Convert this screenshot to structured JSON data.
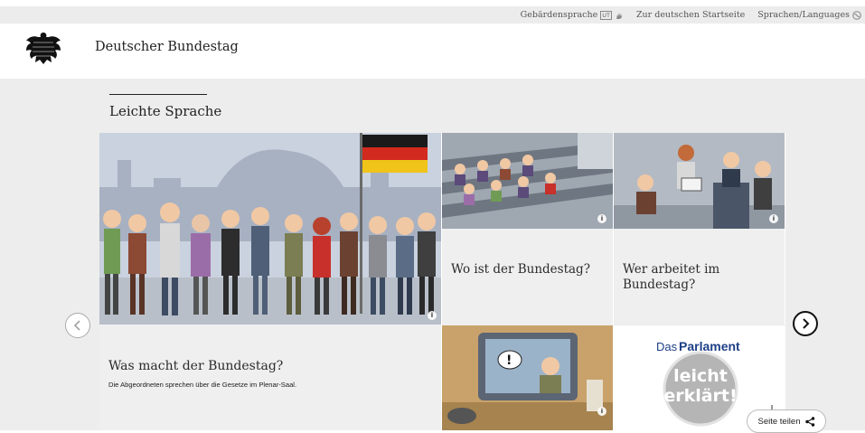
{
  "topbar": {
    "sign_language": "Gebärdensprache",
    "ut_badge": "UT",
    "home_german": "Zur deutschen Startseite",
    "languages": "Sprachen/Languages"
  },
  "header": {
    "site_title": "Deutscher Bundestag"
  },
  "section": {
    "title": "Leichte Sprache"
  },
  "tiles": [
    {
      "title": "Was macht der Bundestag?",
      "description": "Die Abgeordneten sprechen über die Gesetze im Plenar-Saal."
    },
    {
      "title": "Wo ist der Bundestag?"
    },
    {
      "title": "Wer arbeitet im Bundestag?"
    },
    {
      "title": ""
    },
    {
      "logo_das": "Das",
      "logo_parlament": "Parlament",
      "badge_line1": "leicht",
      "badge_line2": "erklärt!"
    }
  ],
  "share": {
    "label": "Seite teilen"
  },
  "colors": {
    "band": "#ededed",
    "logo_blue": "#1d3f87",
    "badge_grey": "#b5b5b5"
  }
}
